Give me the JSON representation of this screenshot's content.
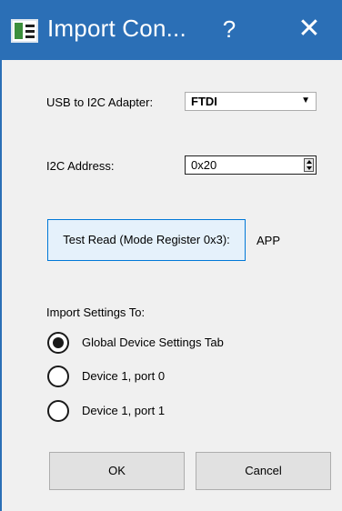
{
  "window": {
    "title": "Import Con...",
    "help_label": "?",
    "close_label": "✕"
  },
  "adapter": {
    "label": "USB to I2C Adapter:",
    "selected": "FTDI",
    "arrow": "▼"
  },
  "address": {
    "label": "I2C Address:",
    "value": "0x20"
  },
  "test": {
    "button_label": "Test Read (Mode Register 0x3):",
    "result": "APP"
  },
  "import": {
    "heading": "Import Settings To:",
    "options": [
      {
        "label": "Global Device Settings Tab",
        "selected": true
      },
      {
        "label": "Device 1, port 0",
        "selected": false
      },
      {
        "label": "Device 1, port 1",
        "selected": false
      }
    ]
  },
  "buttons": {
    "ok_label": "OK",
    "cancel_label": "Cancel"
  },
  "colors": {
    "titlebar": "#2b6fb6",
    "focus_border": "#0078d7"
  }
}
